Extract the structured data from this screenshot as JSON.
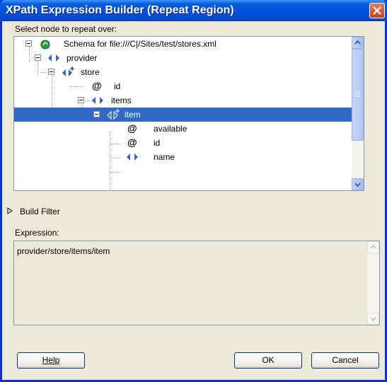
{
  "window": {
    "title": "XPath Expression Builder (Repeat Region)"
  },
  "labels": {
    "select_node": "Select node to repeat over:",
    "build_filter": "Build Filter",
    "expression": "Expression:"
  },
  "tree": {
    "root": "Schema for file:///C|/Sites/test/stores.xml",
    "provider": "provider",
    "store": "store",
    "id": "id",
    "items": "items",
    "item": "item",
    "available": "available",
    "item_id": "id",
    "name": "name"
  },
  "expression": {
    "value": "provider/store/items/item"
  },
  "buttons": {
    "help": "Help",
    "ok": "OK",
    "cancel": "Cancel"
  },
  "colors": {
    "title_bar": "#0053e1",
    "selection": "#316ac5",
    "dialog_bg": "#ece9d8"
  }
}
